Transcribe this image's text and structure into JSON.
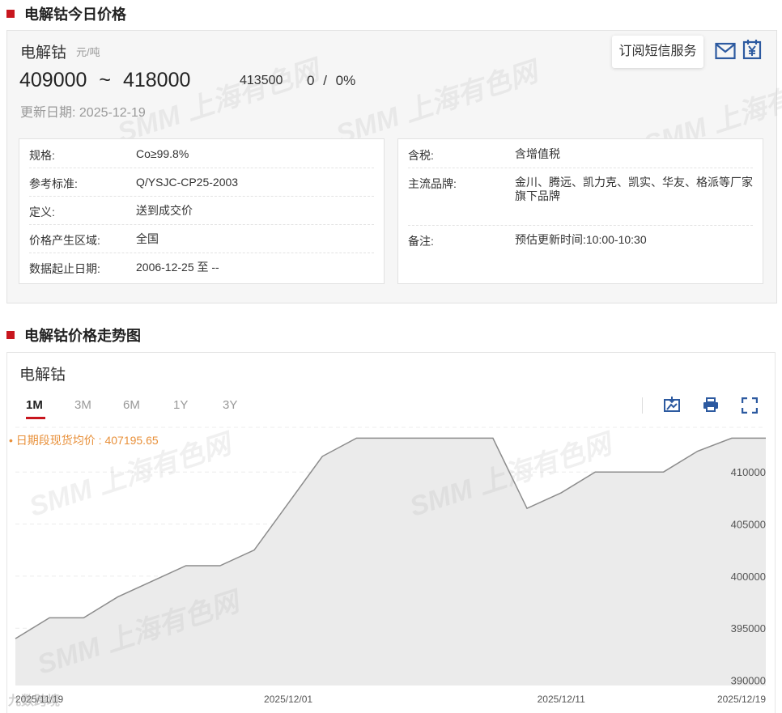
{
  "section1_title": "电解钴今日价格",
  "product": {
    "name": "电解钴",
    "unit": "元/吨"
  },
  "price": {
    "range_low": "409000",
    "tilde": "~",
    "range_high": "418000",
    "avg": "413500",
    "change": "0",
    "slash": "/",
    "change_pct": "0%"
  },
  "update": {
    "label": "更新日期:",
    "date": "2025-12-19"
  },
  "subscribe_label": "订阅短信服务",
  "details_left": [
    {
      "key": "规格:",
      "value": "Co≥99.8%"
    },
    {
      "key": "参考标准:",
      "value": "Q/YSJC-CP25-2003"
    },
    {
      "key": "定义:",
      "value": "送到成交价"
    },
    {
      "key": "价格产生区域:",
      "value": "全国"
    },
    {
      "key": "数据起止日期:",
      "value": "2006-12-25 至 --"
    }
  ],
  "details_right": [
    {
      "key": "含税:",
      "value": "含增值税"
    },
    {
      "key": "主流品牌:",
      "value": "金川、腾远、凯力克、凯实、华友、格派等厂家旗下品牌"
    },
    {
      "key": "备注:",
      "value": "预估更新时间:10:00-10:30"
    }
  ],
  "section2_title": "电解钴价格走势图",
  "chart_card_title": "电解钴",
  "range_tabs": [
    "1M",
    "3M",
    "6M",
    "1Y",
    "3Y"
  ],
  "active_tab": "1M",
  "avg_note": "• 日期段现货均价 : 407195.65",
  "watermark": "SMM 上海有色网",
  "corner_watermark": "九数跨境",
  "colors": {
    "accent": "#c8161e",
    "avg_note": "#e8903a",
    "icon_blue": "#2d5aa0",
    "area_fill": "#e9e9e9",
    "line": "#8c8c8c"
  },
  "icons": [
    "mail-icon",
    "calendar-yen-icon",
    "download-image-icon",
    "print-icon",
    "fullscreen-icon"
  ],
  "chart_data": {
    "type": "area",
    "x": [
      "2025/11/19",
      "2025/11/20",
      "2025/11/21",
      "2025/11/24",
      "2025/11/25",
      "2025/11/26",
      "2025/11/27",
      "2025/11/28",
      "2025/12/01",
      "2025/12/02",
      "2025/12/03",
      "2025/12/04",
      "2025/12/05",
      "2025/12/08",
      "2025/12/09",
      "2025/12/10",
      "2025/12/11",
      "2025/12/12",
      "2025/12/15",
      "2025/12/16",
      "2025/12/17",
      "2025/12/18",
      "2025/12/19"
    ],
    "series": [
      {
        "values": [
          394000,
          396000,
          396000,
          398000,
          399500,
          401000,
          401000,
          402500,
          407000,
          411500,
          413250,
          413250,
          413250,
          413250,
          413250,
          406500,
          408000,
          410000,
          410000,
          410000,
          412000,
          413250,
          413250
        ]
      }
    ],
    "x_tick_labels": [
      "2025/11/19",
      "2025/12/01",
      "2025/12/11",
      "2025/12/19"
    ],
    "y_ticks": [
      390000,
      395000,
      400000,
      405000,
      410000
    ],
    "ylim": [
      389500,
      414600
    ],
    "y_axis_position": "right",
    "grid": true
  }
}
